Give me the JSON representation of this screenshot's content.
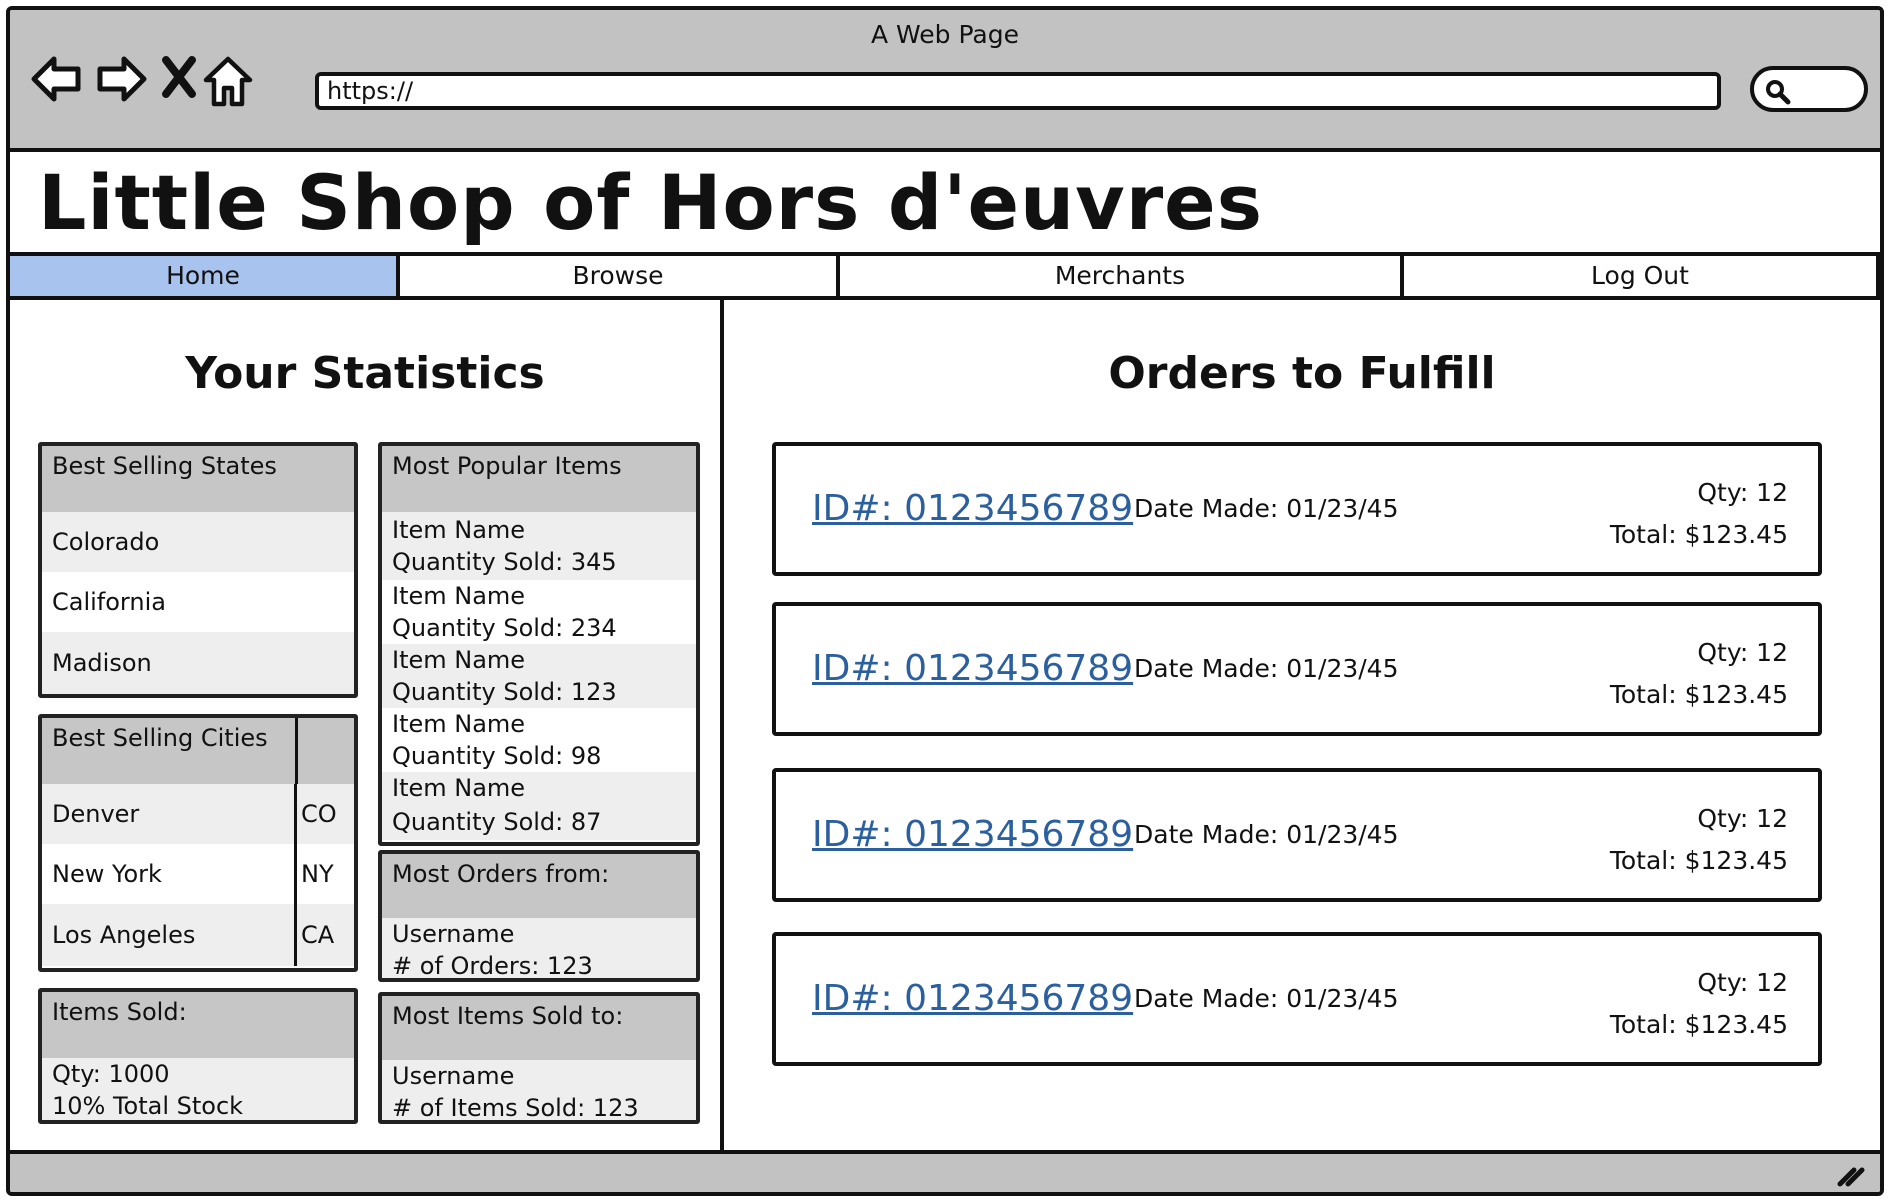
{
  "window": {
    "title": "A Web Page"
  },
  "browser": {
    "url": "https://",
    "icons": [
      "back-arrow-icon",
      "forward-arrow-icon",
      "close-x-icon",
      "home-icon",
      "search-icon"
    ]
  },
  "site": {
    "title": "Little Shop of Hors d'euvres"
  },
  "nav": {
    "tabs": [
      {
        "label": "Home",
        "active": true
      },
      {
        "label": "Browse",
        "active": false
      },
      {
        "label": "Merchants",
        "active": false
      },
      {
        "label": "Log Out",
        "active": false
      }
    ]
  },
  "stats": {
    "title": "Your Statistics",
    "best_states": {
      "header": "Best Selling States",
      "items": [
        "Colorado",
        "California",
        "Madison"
      ]
    },
    "best_cities": {
      "header": "Best Selling Cities",
      "items": [
        {
          "city": "Denver",
          "state": "CO"
        },
        {
          "city": "New York",
          "state": "NY"
        },
        {
          "city": "Los Angeles",
          "state": "CA"
        }
      ]
    },
    "items_sold": {
      "header": "Items Sold:",
      "qty": "Qty: 1000",
      "percent": "10% Total Stock"
    },
    "popular_items": {
      "header": "Most Popular Items",
      "items": [
        {
          "name": "Item Name",
          "qty": "Quantity Sold: 345"
        },
        {
          "name": "Item Name",
          "qty": "Quantity Sold: 234"
        },
        {
          "name": "Item Name",
          "qty": "Quantity Sold: 123"
        },
        {
          "name": "Item Name",
          "qty": "Quantity Sold: 98"
        },
        {
          "name": "Item Name",
          "qty": "Quantity Sold: 87"
        }
      ]
    },
    "most_orders": {
      "header": "Most Orders from:",
      "user": "Username",
      "count": "# of Orders: 123"
    },
    "most_items": {
      "header": "Most Items Sold to:",
      "user": "Username",
      "count": "# of Items Sold: 123"
    }
  },
  "orders": {
    "title": "Orders to Fulfill",
    "items": [
      {
        "id": "ID#: 0123456789",
        "date": "Date Made: 01/23/45",
        "qty": "Qty: 12",
        "total": "Total: $123.45"
      },
      {
        "id": "ID#: 0123456789",
        "date": "Date Made: 01/23/45",
        "qty": "Qty: 12",
        "total": "Total: $123.45"
      },
      {
        "id": "ID#: 0123456789",
        "date": "Date Made: 01/23/45",
        "qty": "Qty: 12",
        "total": "Total: $123.45"
      },
      {
        "id": "ID#: 0123456789",
        "date": "Date Made: 01/23/45",
        "qty": "Qty: 12",
        "total": "Total: $123.45"
      }
    ]
  },
  "colors": {
    "active_tab": "#a8c4ee",
    "chrome": "#c2c2c2",
    "link": "#2b5f9e",
    "card_header": "#c6c6c6"
  }
}
